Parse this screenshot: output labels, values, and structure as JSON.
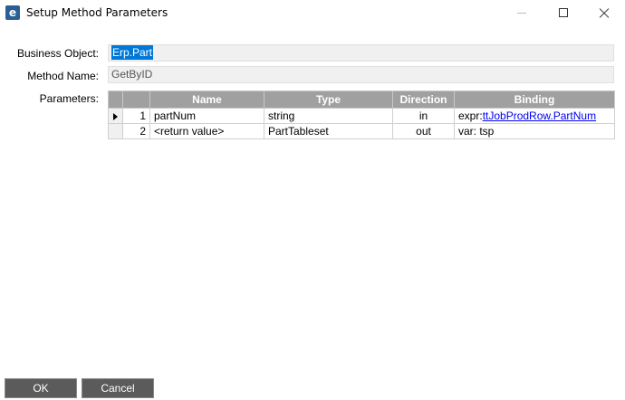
{
  "window": {
    "title": "Setup Method Parameters",
    "app_icon_letter": "e"
  },
  "form": {
    "business_object_label": "Business Object:",
    "business_object_value": "Erp.Part",
    "method_name_label": "Method Name:",
    "method_name_value": "GetByID",
    "parameters_label": "Parameters:"
  },
  "grid": {
    "columns": [
      "Name",
      "Type",
      "Direction",
      "Binding"
    ],
    "rows": [
      {
        "index": "1",
        "name": "partNum",
        "type": "string",
        "direction": "in",
        "binding_prefix": "expr:",
        "binding_link": "ttJobProdRow.PartNum"
      },
      {
        "index": "2",
        "name": "<return value>",
        "type": "PartTableset",
        "direction": "out",
        "binding_prefix": "var: tsp",
        "binding_link": ""
      }
    ]
  },
  "buttons": {
    "ok_label": "OK",
    "cancel_label": "Cancel"
  },
  "colors": {
    "header_bg": "#a0a0a0",
    "selection": "#0078d7",
    "button_bg": "#5b5b5b"
  }
}
